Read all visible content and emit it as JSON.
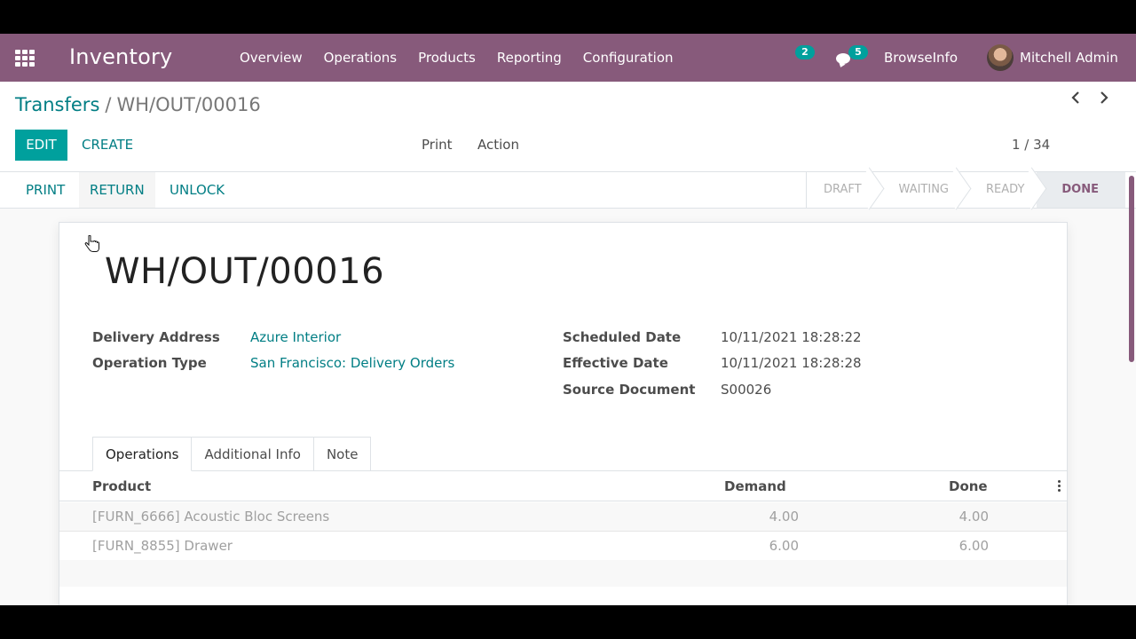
{
  "navbar": {
    "app_title": "Inventory",
    "menu": [
      "Overview",
      "Operations",
      "Products",
      "Reporting",
      "Configuration"
    ],
    "activity_count": "2",
    "messages_count": "5",
    "company": "BrowseInfo",
    "user_name": "Mitchell Admin"
  },
  "control_panel": {
    "breadcrumb_parent": "Transfers",
    "breadcrumb_separator": "/",
    "breadcrumb_current": "WH/OUT/00016",
    "edit_label": "EDIT",
    "create_label": "CREATE",
    "print_label": "Print",
    "action_label": "Action",
    "pager": "1 / 34"
  },
  "statusbar": {
    "buttons": [
      "PRINT",
      "RETURN",
      "UNLOCK"
    ],
    "stages": [
      "DRAFT",
      "WAITING",
      "READY",
      "DONE"
    ],
    "active_stage": "DONE"
  },
  "record": {
    "name": "WH/OUT/00016",
    "left_fields": [
      {
        "label": "Delivery Address",
        "value": "Azure Interior"
      },
      {
        "label": "Operation Type",
        "value": "San Francisco: Delivery Orders"
      }
    ],
    "right_fields": [
      {
        "label": "Scheduled Date",
        "value": "10/11/2021 18:28:22"
      },
      {
        "label": "Effective Date",
        "value": "10/11/2021 18:28:28"
      },
      {
        "label": "Source Document",
        "value": "S00026"
      }
    ]
  },
  "tabs": [
    "Operations",
    "Additional Info",
    "Note"
  ],
  "operations_table": {
    "columns": [
      "Product",
      "Demand",
      "Done"
    ],
    "rows": [
      {
        "product": "[FURN_6666] Acoustic Bloc Screens",
        "demand": "4.00",
        "done": "4.00"
      },
      {
        "product": "[FURN_8855] Drawer",
        "demand": "6.00",
        "done": "6.00"
      }
    ]
  },
  "colors": {
    "brand": "#875a7b",
    "accent": "#00a09d",
    "link": "#017e84"
  }
}
